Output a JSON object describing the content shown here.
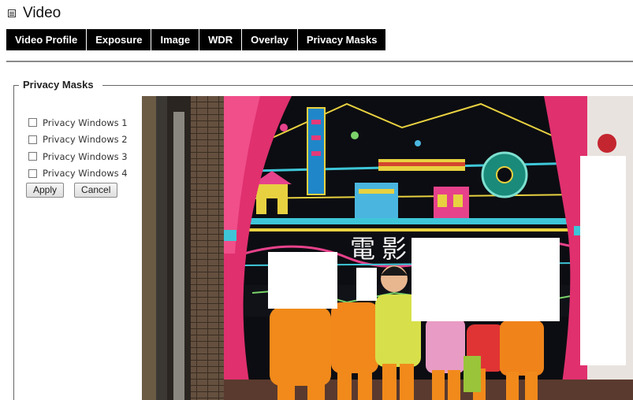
{
  "header": {
    "title": "Video",
    "icon": "video-icon"
  },
  "tabs": [
    "Video Profile",
    "Exposure",
    "Image",
    "WDR",
    "Overlay",
    "Privacy Masks"
  ],
  "privacy": {
    "legend": "Privacy Masks",
    "windows": [
      {
        "label": "Privacy Windows 1",
        "checked": false
      },
      {
        "label": "Privacy Windows 2",
        "checked": false
      },
      {
        "label": "Privacy Windows 3",
        "checked": false
      },
      {
        "label": "Privacy Windows 4",
        "checked": false
      }
    ],
    "apply_label": "Apply",
    "cancel_label": "Cancel"
  },
  "video": {
    "mural_text": [
      "電",
      "影"
    ]
  }
}
